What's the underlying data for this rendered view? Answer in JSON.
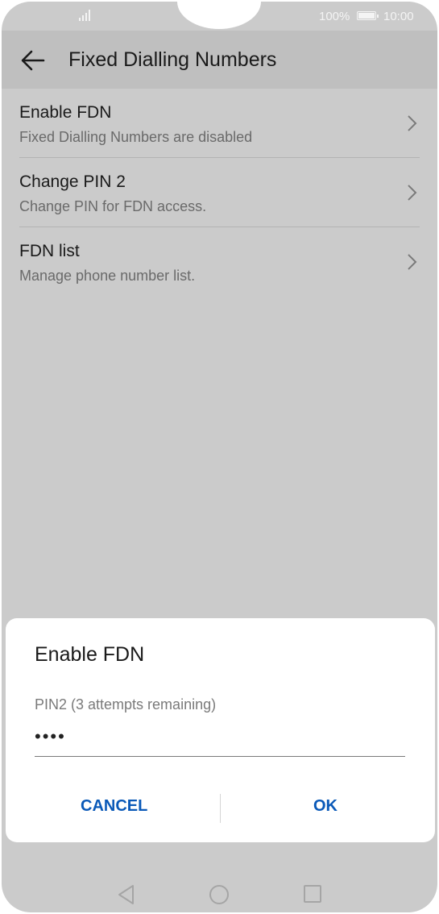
{
  "status_bar": {
    "battery": "100%",
    "time": "10:00"
  },
  "header": {
    "title": "Fixed Dialling Numbers"
  },
  "items": [
    {
      "title": "Enable FDN",
      "subtitle": "Fixed Dialling Numbers are disabled"
    },
    {
      "title": "Change PIN 2",
      "subtitle": "Change PIN for FDN access."
    },
    {
      "title": "FDN list",
      "subtitle": "Manage phone number list."
    }
  ],
  "dialog": {
    "title": "Enable FDN",
    "label": "PIN2 (3 attempts remaining)",
    "value": "••••",
    "cancel": "CANCEL",
    "ok": "OK"
  },
  "colors": {
    "accent": "#0a59b8",
    "screen_dim": "#cbcbcb",
    "header_dim": "#bfbfbf"
  }
}
